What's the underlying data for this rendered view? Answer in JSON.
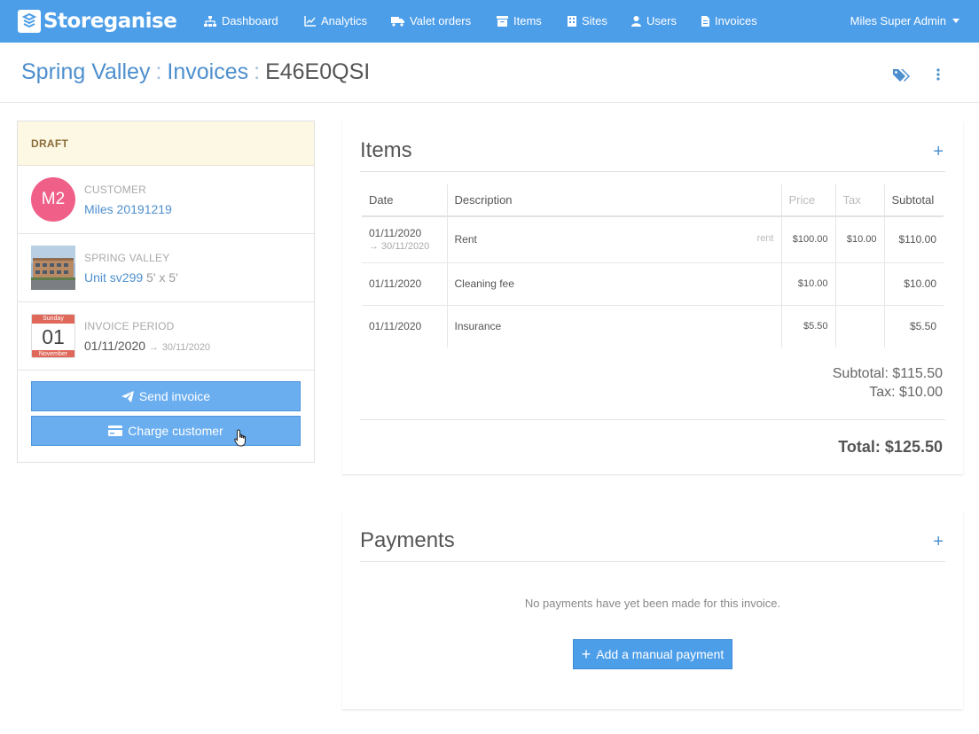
{
  "brand": {
    "name": "Storeganise"
  },
  "nav": {
    "items": [
      {
        "label": "Dashboard",
        "icon": "sitemap-icon"
      },
      {
        "label": "Analytics",
        "icon": "chart-icon"
      },
      {
        "label": "Valet orders",
        "icon": "truck-icon"
      },
      {
        "label": "Items",
        "icon": "archive-icon"
      },
      {
        "label": "Sites",
        "icon": "building-icon"
      },
      {
        "label": "Users",
        "icon": "user-icon"
      },
      {
        "label": "Invoices",
        "icon": "file-icon"
      }
    ],
    "user": "Miles Super Admin"
  },
  "breadcrumb": {
    "site": "Spring Valley",
    "section": "Invoices",
    "current": "E46E0QSI",
    "separator": ":"
  },
  "status": {
    "label": "DRAFT"
  },
  "customer": {
    "initials": "M2",
    "label": "CUSTOMER",
    "name": "Miles 20191219"
  },
  "unit": {
    "label": "SPRING VALLEY",
    "name": "Unit sv299",
    "size": "5' x 5'"
  },
  "period": {
    "label": "INVOICE PERIOD",
    "weekday": "Sunday",
    "day": "01",
    "month": "November",
    "start": "01/11/2020",
    "arrow": "→",
    "end": "30/11/2020"
  },
  "actions": {
    "send": "Send invoice",
    "charge": "Charge customer"
  },
  "items_card": {
    "title": "Items",
    "add": "+",
    "columns": {
      "date": "Date",
      "description": "Description",
      "price": "Price",
      "tax": "Tax",
      "subtotal": "Subtotal"
    },
    "rows": [
      {
        "date": "01/11/2020",
        "date_end": "→ 30/11/2020",
        "description": "Rent",
        "tag": "rent",
        "price": "$100.00",
        "tax": "$10.00",
        "subtotal": "$110.00"
      },
      {
        "date": "01/11/2020",
        "date_end": "",
        "description": "Cleaning fee",
        "tag": "",
        "price": "$10.00",
        "tax": "",
        "subtotal": "$10.00"
      },
      {
        "date": "01/11/2020",
        "date_end": "",
        "description": "Insurance",
        "tag": "",
        "price": "$5.50",
        "tax": "",
        "subtotal": "$5.50"
      }
    ],
    "subtotal": "Subtotal: $115.50",
    "tax": "Tax: $10.00",
    "total": "Total: $125.50"
  },
  "payments_card": {
    "title": "Payments",
    "add": "+",
    "empty": "No payments have yet been made for this invoice.",
    "button": "Add a manual payment"
  },
  "colors": {
    "navbar": "#4d9ee9",
    "link": "#4d8fce",
    "avatar": "#ef5f88",
    "draft_bg": "#fdf8e4"
  }
}
